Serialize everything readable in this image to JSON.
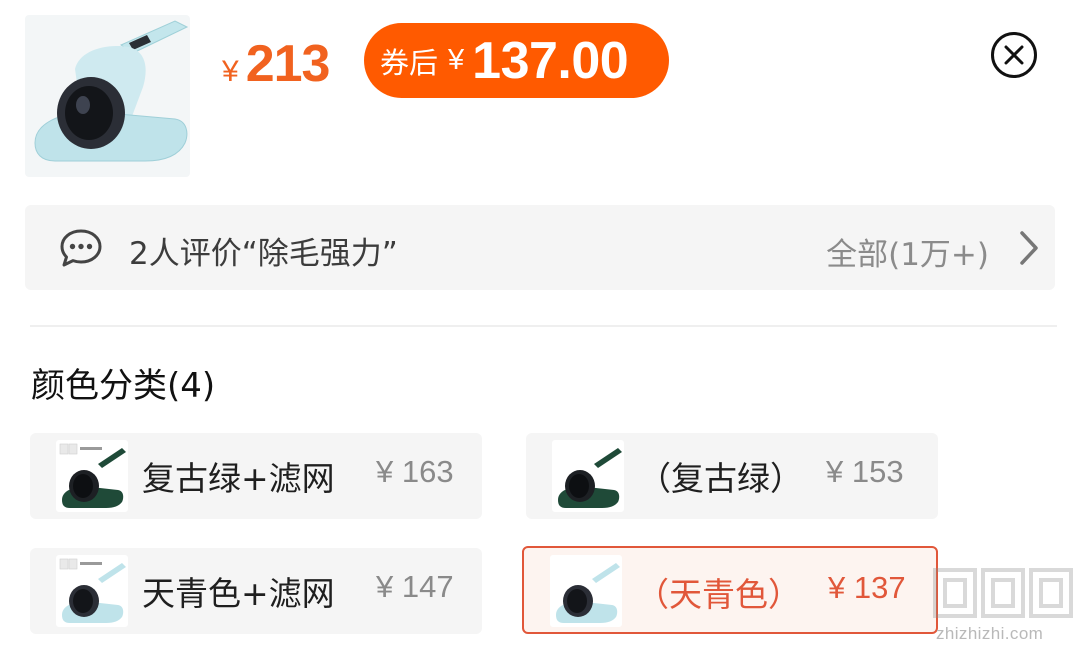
{
  "product": {
    "image_icon": "mite-vacuum-light-blue-image",
    "price_original": {
      "currency": "¥",
      "value": "213"
    },
    "coupon": {
      "label": "券后",
      "currency": "¥",
      "value": "137.00"
    }
  },
  "close_icon": "close-circle-icon",
  "reviews": {
    "icon": "chat-bubble-icon",
    "text": "2人评价“除毛强力”",
    "all_label": "全部(1万+)",
    "chevron_icon": "chevron-right-icon"
  },
  "color_section": {
    "title": "颜色分类(4)",
    "options": [
      {
        "name": "复古绿+滤网",
        "price": "¥ 163",
        "color": "#1f4a38",
        "selected": false
      },
      {
        "name": "（复古绿）",
        "price": "¥ 153",
        "color": "#1f4a38",
        "selected": false
      },
      {
        "name": "天青色+滤网",
        "price": "¥ 147",
        "color": "#bfe3ea",
        "selected": false
      },
      {
        "name": "（天青色）",
        "price": "¥ 137",
        "color": "#bfe3ea",
        "selected": true
      }
    ]
  },
  "colors": {
    "price_orange": "#f1621f",
    "coupon_bg": "#ff5a00",
    "selected_border": "#e1573a",
    "option_bg": "#f5f5f5"
  },
  "watermark": {
    "glyphs": "值值值",
    "site": "zhizhizhi.com"
  }
}
